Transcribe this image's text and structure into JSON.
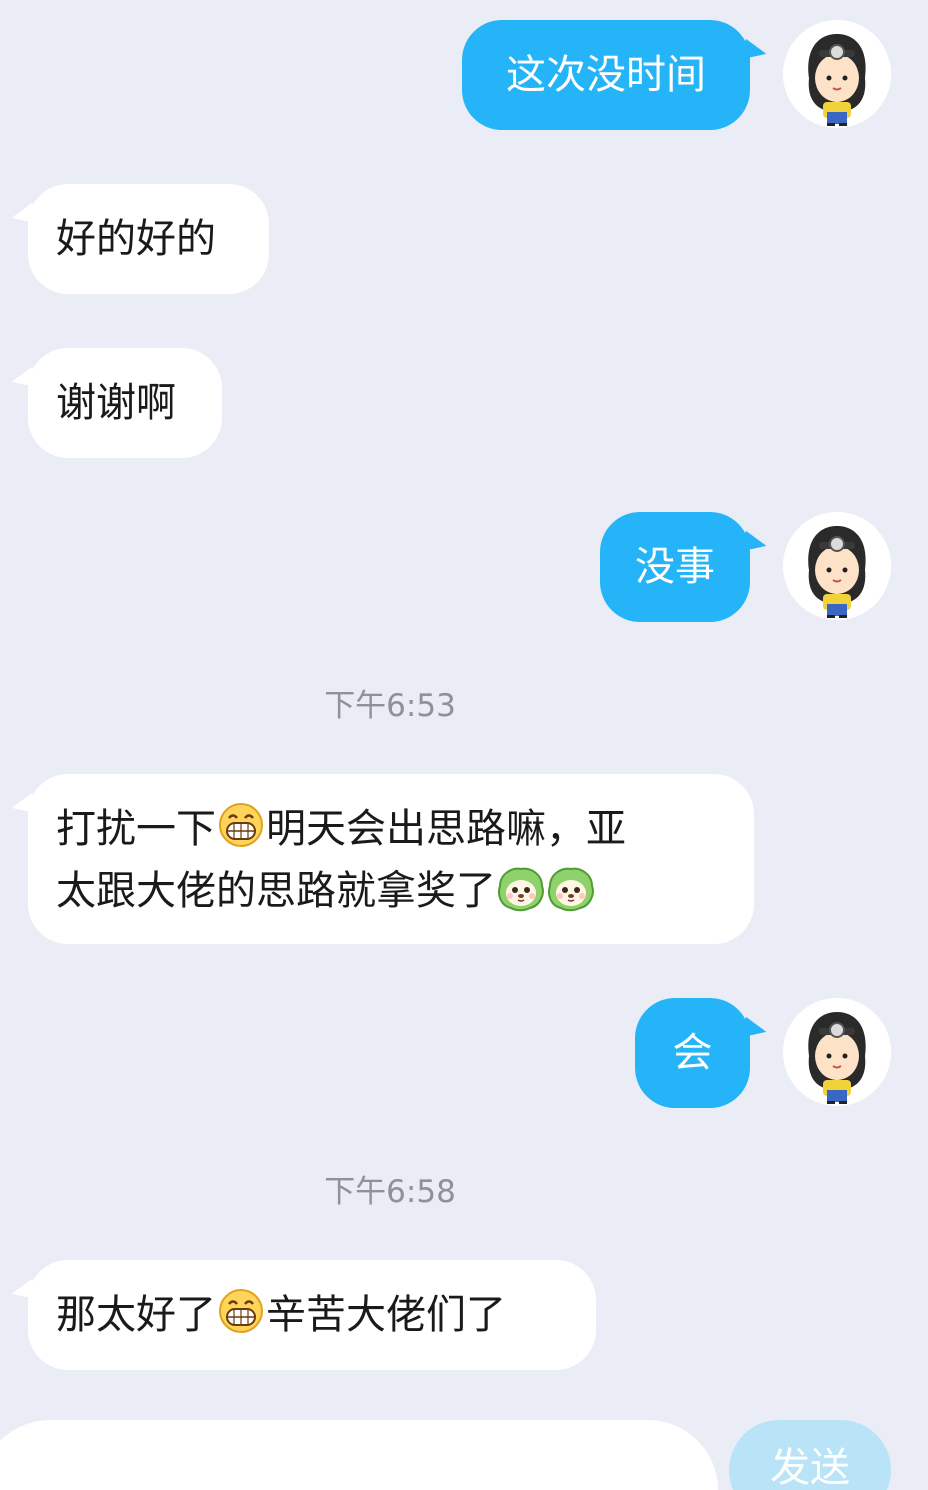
{
  "messages": [
    {
      "side": "out",
      "text": "这次没时间"
    },
    {
      "side": "in",
      "text": "好的好的"
    },
    {
      "side": "in",
      "text": "谢谢啊"
    },
    {
      "side": "out",
      "text": "没事"
    },
    {
      "side": "in",
      "line1_a": "打扰一下",
      "line1_b": "明天会出思路嘛，亚",
      "line2": "太跟大佬的思路就拿奖了"
    },
    {
      "side": "out",
      "text": "会"
    },
    {
      "side": "in",
      "text_a": "那太好了",
      "text_b": "辛苦大佬们了"
    }
  ],
  "timestamps": [
    "下午6:53",
    "下午6:58"
  ],
  "composer": {
    "send_label": "发送"
  },
  "colors": {
    "background": "#eaedf6",
    "outgoing_bubble": "#24b4f7",
    "incoming_bubble": "#ffffff",
    "send_disabled": "#b9e4f8"
  },
  "icons": [
    "grin-emoji-icon",
    "cabbage-dog-sticker-icon",
    "user-avatar-icon"
  ]
}
